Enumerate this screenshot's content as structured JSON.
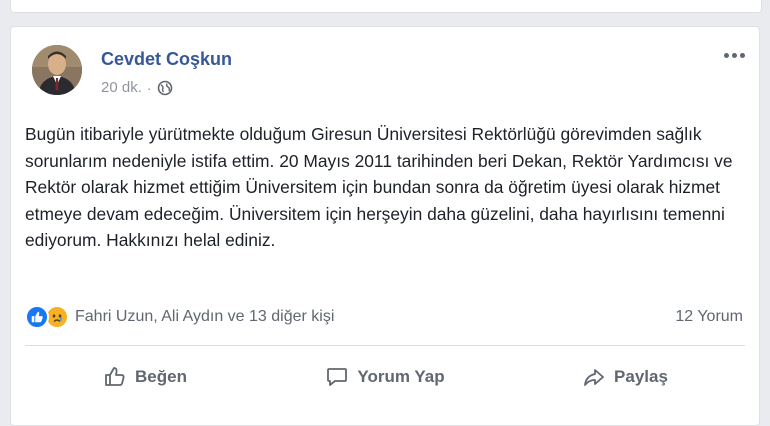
{
  "post": {
    "author": "Cevdet Coşkun",
    "time": "20 dk.",
    "separator": "·",
    "privacy_icon": "globe-icon",
    "text": "Bugün itibariyle yürütmekte olduğum Giresun Üniversitesi Rektörlüğü görevimden sağlık sorunlarım nedeniyle istifa ettim. 20 Mayıs 2011 tarihinden beri Dekan, Rektör Yardımcısı ve Rektör olarak hizmet ettiğim Üniversitem için bundan sonra da öğretim üyesi olarak hizmet etmeye devam edeceğim. Üniversitem için herşeyin daha güzelini, daha hayırlısını temenni ediyorum. Hakkınızı helal ediniz.",
    "reactions": {
      "icons": [
        "like-icon",
        "sad-icon"
      ],
      "text": "Fahri Uzun, Ali Aydın ve 13 diğer kişi"
    },
    "comment_count": "12 Yorum",
    "actions": {
      "like": "Beğen",
      "comment": "Yorum Yap",
      "share": "Paylaş"
    }
  },
  "colors": {
    "author": "#365899",
    "like_blue": "#1877f2",
    "sad_yellow": "#f7b125",
    "secondary_text": "#606770"
  }
}
